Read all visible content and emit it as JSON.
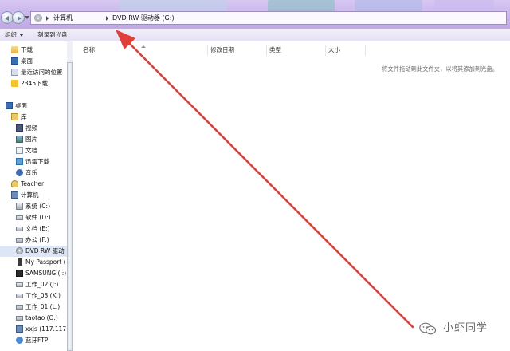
{
  "colors": {
    "title_bar": "#cbb7ee",
    "selected_row": "#dde6f4",
    "annotation_arrow": "#e0403a"
  },
  "address_bar": {
    "icon": "optical-drive-icon",
    "crumbs": [
      "计算机",
      "DVD RW 驱动器 (G:)"
    ]
  },
  "toolbar": {
    "organize_label": "组织",
    "burn_label": "刻录到光盘"
  },
  "nav_pane": {
    "items": [
      {
        "label": "下载",
        "icon": "download-folder-icon"
      },
      {
        "label": "桌面",
        "icon": "desktop-icon"
      },
      {
        "label": "最近访问的位置",
        "icon": "recent-places-icon"
      },
      {
        "label": "2345下载",
        "icon": "folder-icon"
      },
      {
        "label": "桌面",
        "icon": "desktop-icon"
      },
      {
        "label": "库",
        "icon": "library-icon"
      },
      {
        "label": "视频",
        "icon": "video-library-icon"
      },
      {
        "label": "图片",
        "icon": "pictures-library-icon"
      },
      {
        "label": "文档",
        "icon": "documents-library-icon"
      },
      {
        "label": "迅雷下载",
        "icon": "thunder-download-icon"
      },
      {
        "label": "音乐",
        "icon": "music-library-icon"
      },
      {
        "label": "Teacher",
        "icon": "user-folder-icon"
      },
      {
        "label": "计算机",
        "icon": "computer-icon"
      },
      {
        "label": "系统 (C:)",
        "icon": "system-drive-icon"
      },
      {
        "label": "软件 (D:)",
        "icon": "drive-icon"
      },
      {
        "label": "文档 (E:)",
        "icon": "drive-icon"
      },
      {
        "label": "办公 (F:)",
        "icon": "drive-icon"
      },
      {
        "label": "DVD RW 驱动",
        "icon": "dvd-drive-icon",
        "selected": true
      },
      {
        "label": "My Passport (",
        "icon": "portable-device-icon"
      },
      {
        "label": "SAMSUNG (I:)",
        "icon": "removable-drive-icon"
      },
      {
        "label": "工作_02 (J:)",
        "icon": "drive-icon"
      },
      {
        "label": "工作_03 (K:)",
        "icon": "drive-icon"
      },
      {
        "label": "工作_01 (L:)",
        "icon": "drive-icon"
      },
      {
        "label": "taotao (O:)",
        "icon": "drive-icon"
      },
      {
        "label": "xxjs (117.117.",
        "icon": "network-drive-icon"
      },
      {
        "label": "蓝牙FTP",
        "icon": "bluetooth-ftp-icon"
      }
    ]
  },
  "content": {
    "columns": {
      "name": "名称",
      "date": "修改日期",
      "type": "类型",
      "size": "大小"
    },
    "drop_hint": "将文件拖动到此文件夹，以将其添加到光盘。"
  },
  "watermark": {
    "text": "小虾同学",
    "icon": "wechat-logo-icon"
  }
}
